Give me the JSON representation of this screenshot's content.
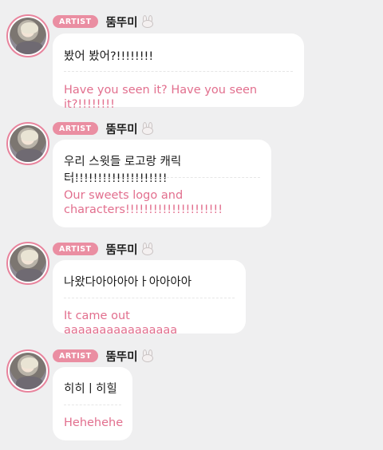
{
  "messages": [
    {
      "badge": "ARTIST",
      "name": "뚬뚜미",
      "original": "봤어 봤어?!!!!!!!!",
      "translation": "Have you seen it? Have you seen it?!!!!!!!!"
    },
    {
      "badge": "ARTIST",
      "name": "뚬뚜미",
      "original": "우리 스윗들 로고랑 캐릭터!!!!!!!!!!!!!!!!!!!!",
      "translation_lines": [
        "Our sweets logo and",
        "characters!!!!!!!!!!!!!!!!!!!!!"
      ]
    },
    {
      "badge": "ARTIST",
      "name": "뚬뚜미",
      "original": "나왔다아아아아ㅏ아아아아",
      "translation": "It came out aaaaaaaaaaaaaaaa"
    },
    {
      "badge": "ARTIST",
      "name": "뚬뚜미",
      "original": "히히ㅣ히힐",
      "translation": "Hehehehe"
    }
  ],
  "icons": {
    "avatar": "profile-photo",
    "name_emoji": "rabbit-face-icon"
  },
  "colors": {
    "badge": "#ea8ea2",
    "translation": "#e26f8e",
    "background": "#efeff0"
  }
}
